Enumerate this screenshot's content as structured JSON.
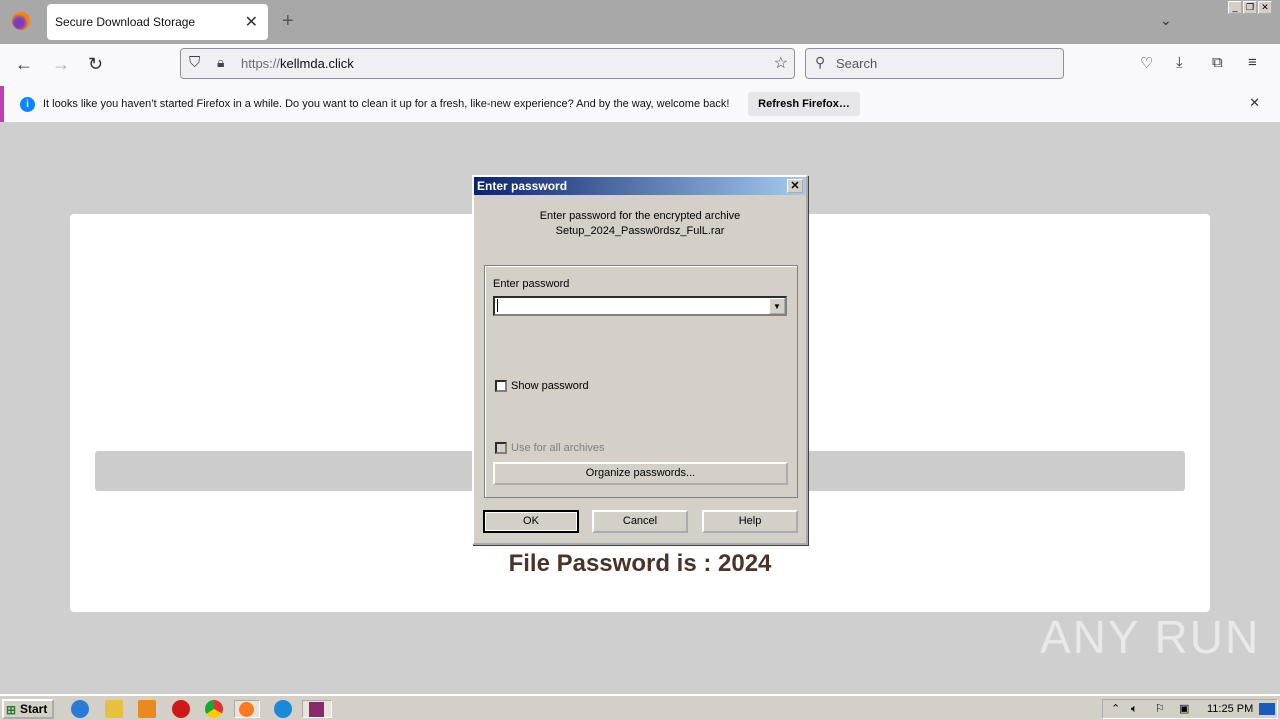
{
  "browser": {
    "tab_title": "Secure Download Storage",
    "url_prefix": "https://",
    "url_host": "kellmda.click",
    "search_placeholder": "Search",
    "notification": "It looks like you haven’t started Firefox in a while. Do you want to clean it up for a fresh, like-new experience? And by the way, welcome back!",
    "refresh_label": "Refresh Firefox…"
  },
  "page": {
    "password_text": "File Password is : 2024",
    "watermark": "ANY RUN"
  },
  "dialog": {
    "title": "Enter password",
    "line1": "Enter password for the encrypted archive",
    "line2": "Setup_2024_Passw0rdsz_FulL.rar",
    "field_label": "Enter password",
    "password_value": "",
    "show_password": "Show password",
    "use_all": "Use for all archives",
    "organize": "Organize passwords...",
    "ok": "OK",
    "cancel": "Cancel",
    "help": "Help"
  },
  "taskbar": {
    "start": "Start",
    "clock": "11:25 PM"
  }
}
